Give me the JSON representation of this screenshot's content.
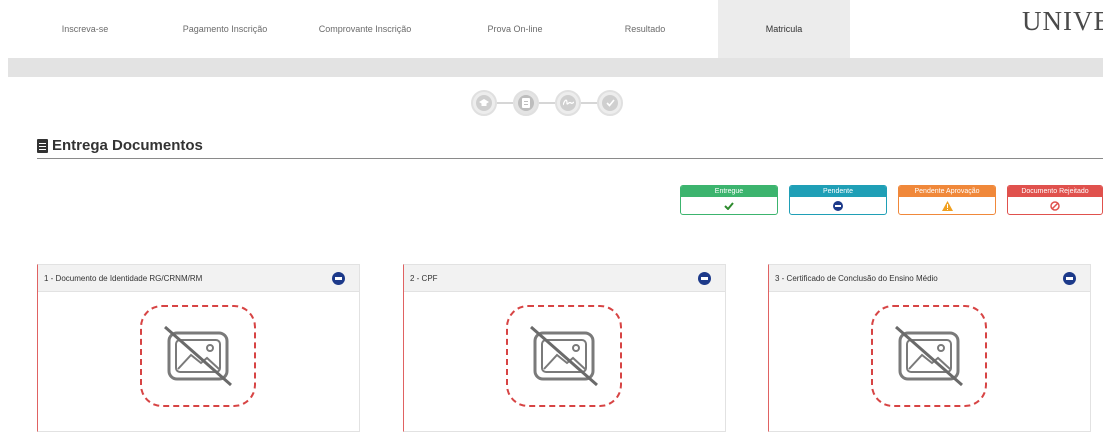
{
  "nav": {
    "tabs": [
      {
        "label": "Inscreva-se"
      },
      {
        "label": "Pagamento Inscrição"
      },
      {
        "label": "Comprovante Inscrição"
      },
      {
        "label": "Prova On-line"
      },
      {
        "label": "Resultado"
      },
      {
        "label": "Matricula"
      }
    ],
    "active_tab": "Matricula",
    "logo_text": "UNIVESP"
  },
  "stepper": {
    "steps": [
      "graduation-cap-icon",
      "document-icon",
      "signature-icon",
      "check-icon"
    ],
    "current_step": 2
  },
  "section": {
    "title": "Entrega Documentos"
  },
  "legend": [
    {
      "label": "Entregue",
      "icon": "check-icon",
      "color": "#3cb46e"
    },
    {
      "label": "Pendente",
      "icon": "minus-circle-icon",
      "color": "#1f9fb6"
    },
    {
      "label": "Pendente Aprovação",
      "icon": "warning-icon",
      "color": "#f0883a"
    },
    {
      "label": "Documento Rejeitado",
      "icon": "ban-icon",
      "color": "#e0514d"
    }
  ],
  "documents": [
    {
      "title": "1 - Documento de Identidade RG/CRNM/RM",
      "status": "pendente"
    },
    {
      "title": "2 - CPF",
      "status": "pendente"
    },
    {
      "title": "3 - Certificado de Conclusão do Ensino Médio",
      "status": "pendente"
    }
  ],
  "colors": {
    "status_pendente": "#1d3a8a",
    "placeholder_border": "#d74444",
    "card_left_border": "#e06262"
  }
}
